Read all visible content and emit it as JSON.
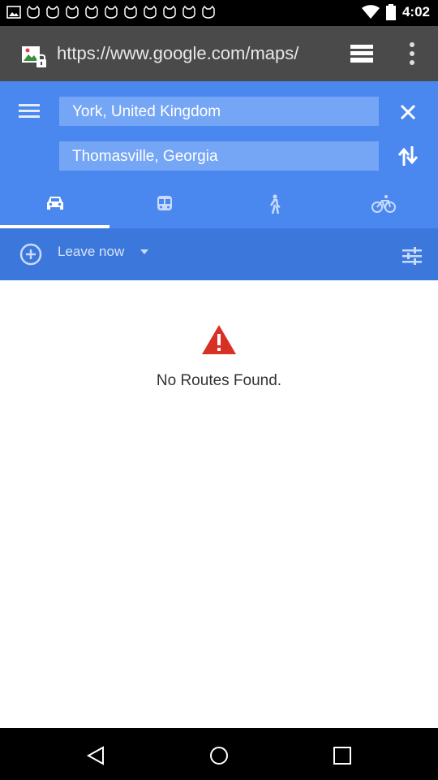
{
  "status_bar": {
    "time": "4:02",
    "notification_icons": [
      "image-icon",
      "cat-icon",
      "cat-icon",
      "cat-icon",
      "cat-icon",
      "cat-icon",
      "cat-icon",
      "cat-icon",
      "cat-icon",
      "cat-icon",
      "cat-icon"
    ],
    "right_icons": [
      "wifi-icon",
      "battery-icon"
    ]
  },
  "browser": {
    "url": "https://www.google.com/maps/",
    "tabs_icon": "tabs-icon",
    "menu_icon": "more-vert-icon"
  },
  "directions": {
    "origin": "York, United Kingdom",
    "destination": "Thomasville, Georgia",
    "modes": [
      "car-icon",
      "transit-icon",
      "walk-icon",
      "bike-icon"
    ],
    "selected_mode": "car",
    "accent_color": "#4a88f0",
    "time_bar_color": "#3c78db"
  },
  "time_option": {
    "label": "Leave now"
  },
  "result": {
    "message": "No Routes Found.",
    "warning_color": "#d93025"
  },
  "nav_bar": {
    "buttons": [
      "back-icon",
      "home-icon",
      "recents-icon"
    ]
  }
}
